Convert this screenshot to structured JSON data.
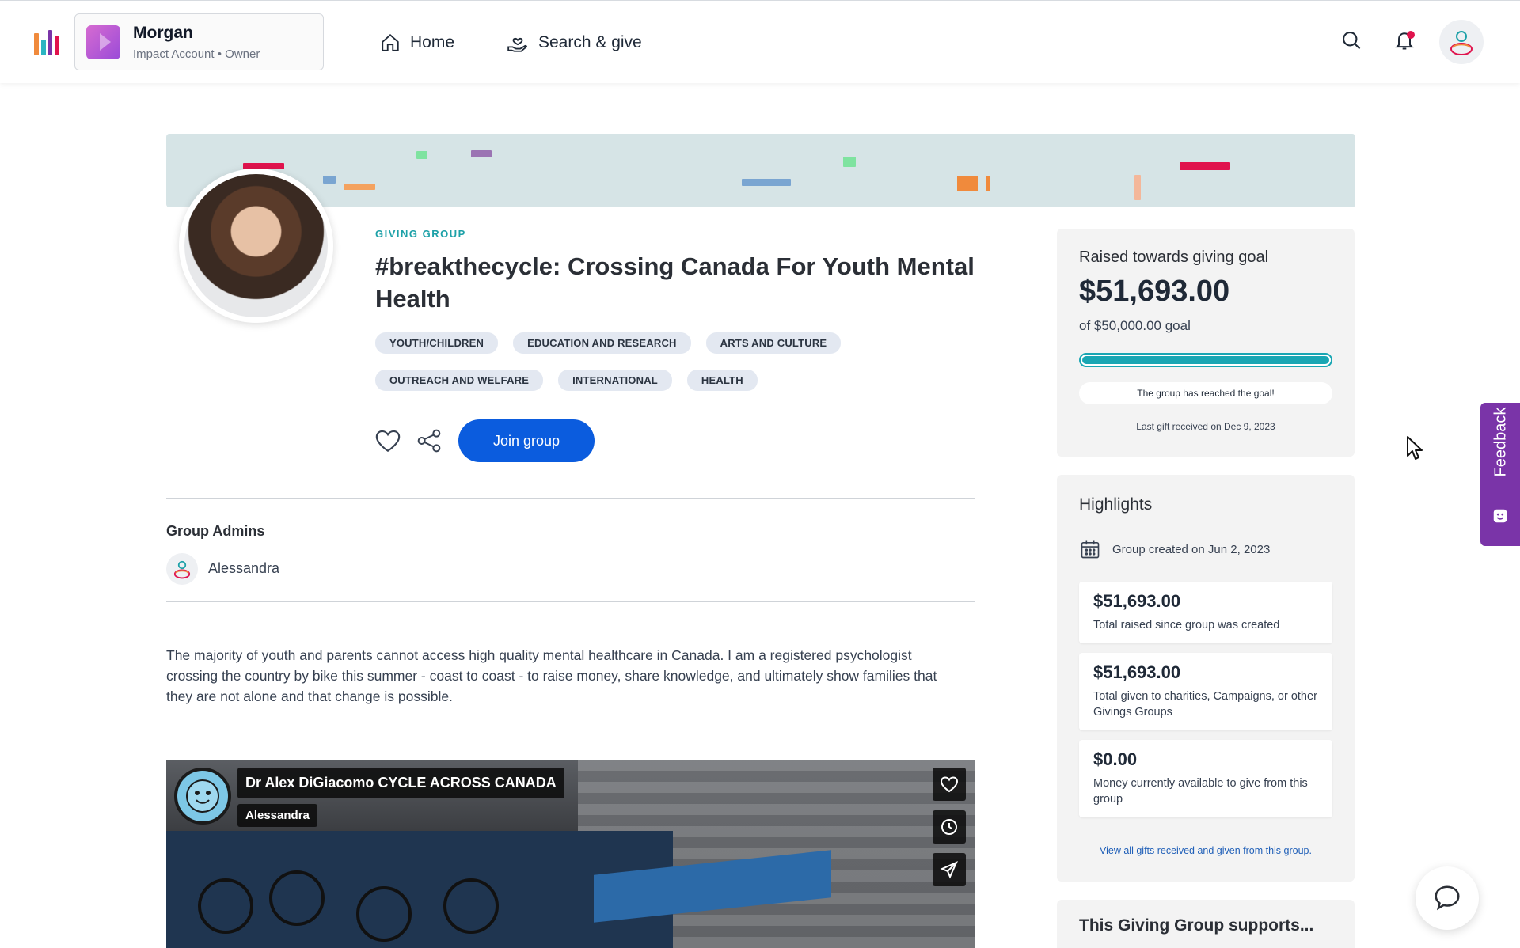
{
  "colors": {
    "primary": "#0b5cde",
    "teal": "#1da1a8",
    "feedback": "#7a34a8",
    "notification_dot": "#e0134d"
  },
  "account": {
    "name": "Morgan",
    "type": "Impact Account",
    "role": "Owner"
  },
  "nav": {
    "home": "Home",
    "search_give": "Search & give"
  },
  "group": {
    "eyebrow": "GIVING GROUP",
    "title": "#breakthecycle: Crossing Canada For Youth Mental Health",
    "tags": [
      "YOUTH/CHILDREN",
      "EDUCATION AND RESEARCH",
      "ARTS AND CULTURE",
      "OUTREACH AND WELFARE",
      "INTERNATIONAL",
      "HEALTH"
    ],
    "join_label": "Join group",
    "admins_heading": "Group Admins",
    "admin_name": "Alessandra",
    "description": "The majority of youth and parents cannot access high quality mental healthcare in Canada. I am a registered psychologist crossing the country by bike this summer - coast to coast - to raise money, share knowledge, and ultimately show families that they are not alone and that change is possible."
  },
  "video": {
    "title": "Dr Alex DiGiacomo CYCLE ACROSS CANADA",
    "channel": "Alessandra"
  },
  "goal": {
    "heading": "Raised towards giving goal",
    "raised": "$51,693.00",
    "goal_text": "of $50,000.00 goal",
    "progress": 1.0,
    "reached_msg": "The group has reached the goal!",
    "last_gift": "Last gift received on Dec 9, 2023"
  },
  "highlights": {
    "heading": "Highlights",
    "created": "Group created on Jun 2, 2023",
    "stats": [
      {
        "value": "$51,693.00",
        "label": "Total raised since group was created"
      },
      {
        "value": "$51,693.00",
        "label": "Total given to charities, Campaigns, or other Givings Groups"
      },
      {
        "value": "$0.00",
        "label": "Money currently available to give from this group"
      }
    ],
    "link": "View all gifts received and given from this group."
  },
  "supports": {
    "heading": "This Giving Group supports..."
  },
  "feedback_label": "Feedback"
}
